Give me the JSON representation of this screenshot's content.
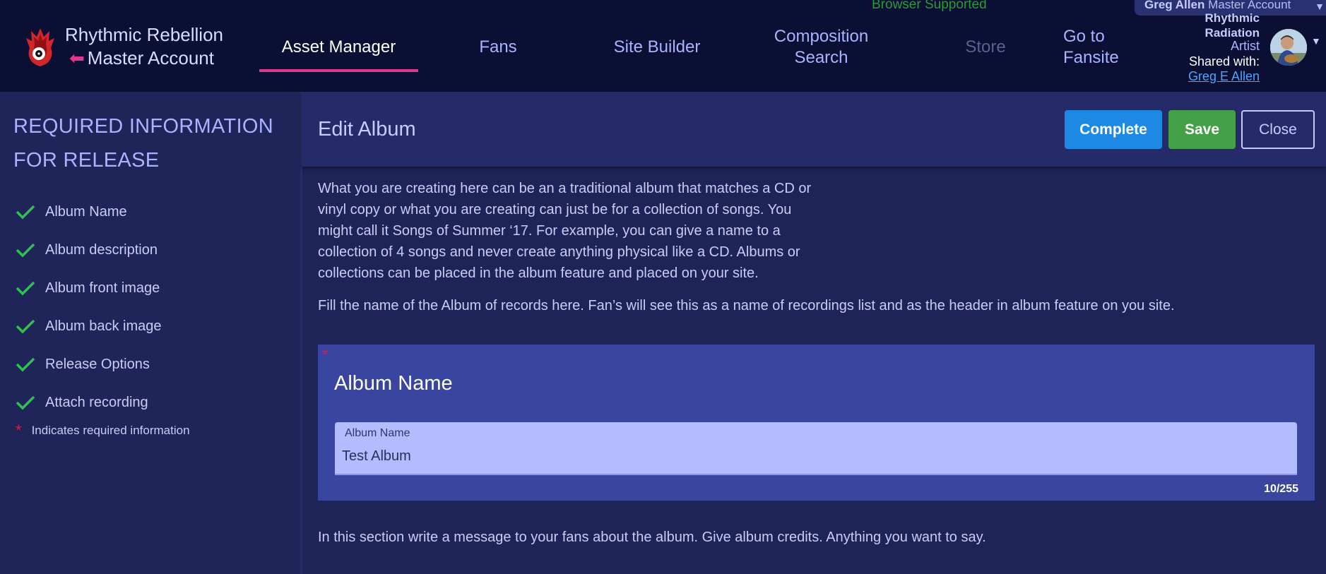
{
  "topbar": {
    "browser_note": "Browser Supported",
    "account_chip": {
      "user": "Greg Allen",
      "account": "Master Account"
    },
    "brand": {
      "title": "Rhythmic Rebellion",
      "back_label": "Master Account"
    },
    "nav": [
      {
        "label": "Asset Manager",
        "active": true
      },
      {
        "label": "Fans"
      },
      {
        "label": "Site Builder"
      },
      {
        "label": "Composition Search"
      },
      {
        "label": "Store",
        "disabled": true
      },
      {
        "label": "Go to Fansite"
      }
    ],
    "profile": {
      "name_line1": "Rhythmic",
      "name_line2": "Radiation",
      "role": "Artist",
      "shared_label": "Shared with:",
      "shared_user": "Greg E Allen"
    }
  },
  "sidebar": {
    "heading": "REQUIRED INFORMATION FOR RELEASE",
    "items": [
      {
        "label": "Album Name",
        "done": true
      },
      {
        "label": "Album description",
        "done": true
      },
      {
        "label": "Album front image",
        "done": true
      },
      {
        "label": "Album back image",
        "done": true
      },
      {
        "label": "Release Options",
        "done": true
      },
      {
        "label": "Attach recording",
        "done": true
      }
    ],
    "note": "Indicates required information"
  },
  "main": {
    "title": "Edit Album",
    "buttons": {
      "complete": "Complete",
      "save": "Save",
      "close": "Close"
    },
    "intro": "What you are creating here can be an a traditional album that matches a CD or vinyl copy or what you are creating can just be for a collection of songs. You might call it Songs of Summer ‘17. For example, you can give a name to a collection of 4 songs and never create anything physical like a CD. Albums or collections can be placed in the album feature and placed on your site.",
    "hint": "Fill the name of the Album of records here. Fan’s will see this as a name of recordings list and as the header in album feature on you site.",
    "album_card": {
      "title": "Album Name",
      "field_label": "Album Name",
      "field_value": "Test Album",
      "counter": "10/255"
    },
    "message_hint": "In this section write a message to your fans about the album. Give album credits. Anything you want to say."
  },
  "colors": {
    "accent_pink": "#e0368d",
    "complete_blue": "#1e88e5",
    "save_green": "#43a047",
    "check_green": "#2ec24a",
    "required_red": "#e0174a"
  }
}
